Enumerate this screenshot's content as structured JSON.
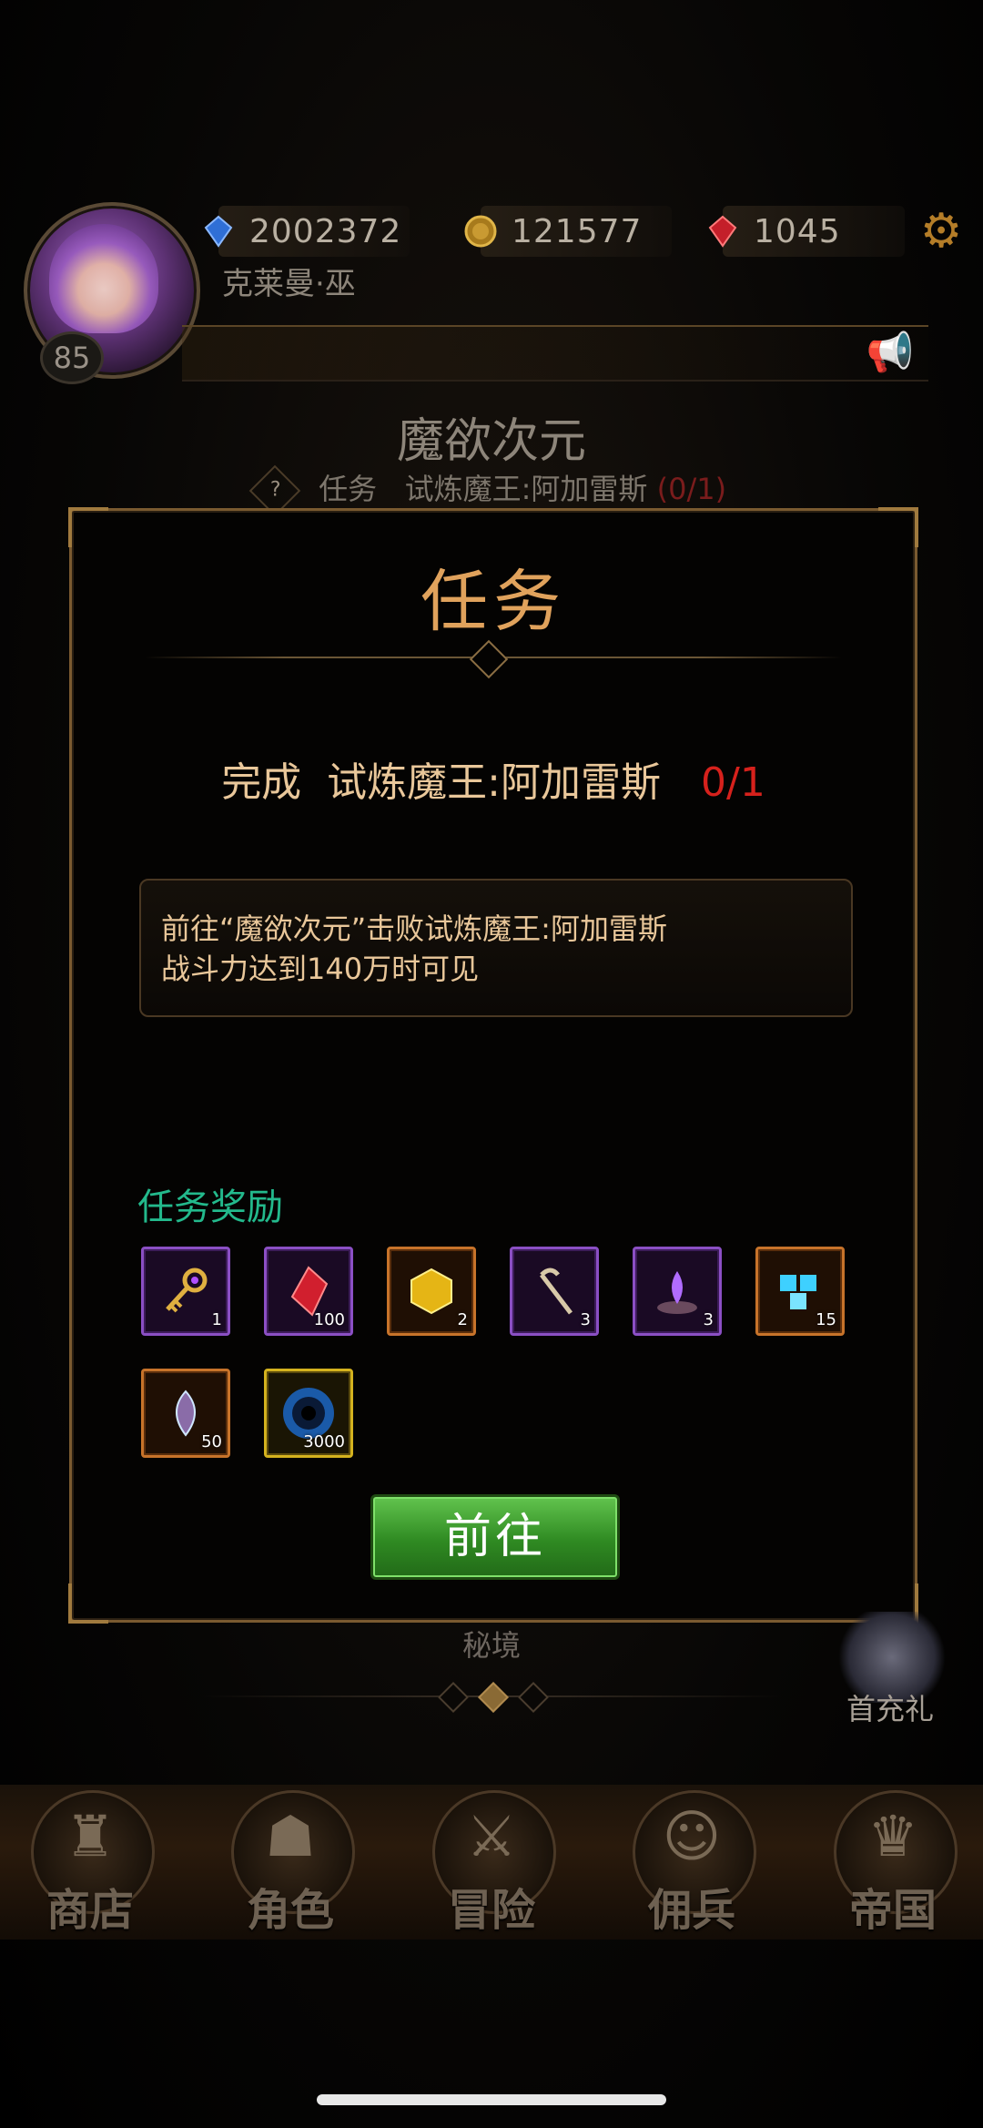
{
  "header": {
    "player_name": "克莱曼·巫",
    "level": "85",
    "currencies": [
      {
        "name": "diamond",
        "icon": "blue-gem-icon",
        "value": "2002372"
      },
      {
        "name": "gold",
        "icon": "gold-coin-icon",
        "value": "121577"
      },
      {
        "name": "ruby",
        "icon": "red-gem-icon",
        "value": "1045"
      }
    ]
  },
  "area": {
    "title": "魔欲次元",
    "quest_prefix": "任务",
    "quest_name": "试炼魔王:阿加雷斯",
    "quest_progress": "(0/1)"
  },
  "modal": {
    "title": "任务",
    "objective_prefix": "完成",
    "objective_target": "试炼魔王:阿加雷斯",
    "objective_count": "0/1",
    "description_line1": "前往“魔欲次元”击败试炼魔王:阿加雷斯",
    "description_line2": "战斗力达到140万时可见",
    "rewards_label": "任务奖励",
    "rewards": [
      {
        "icon": "golden-key-icon",
        "qty": "1"
      },
      {
        "icon": "red-crystal-icon",
        "qty": "100"
      },
      {
        "icon": "yellow-gem-icon",
        "qty": "2"
      },
      {
        "icon": "staff-icon",
        "qty": "3"
      },
      {
        "icon": "purple-flame-altar-icon",
        "qty": "3"
      },
      {
        "icon": "blue-cubes-icon",
        "qty": "15"
      },
      {
        "icon": "soul-crystal-icon",
        "qty": "50"
      },
      {
        "icon": "vortex-orb-icon",
        "qty": "3000"
      }
    ],
    "go_button": "前往"
  },
  "below": {
    "secret_label": "秘境",
    "first_charge_label": "首充礼"
  },
  "nav": {
    "items": [
      {
        "label": "商店",
        "icon": "castle-icon"
      },
      {
        "label": "角色",
        "icon": "hooded-figure-icon"
      },
      {
        "label": "冒险",
        "icon": "crossed-swords-icon"
      },
      {
        "label": "佣兵",
        "icon": "mercenary-portrait-icon"
      },
      {
        "label": "帝国",
        "icon": "crown-icon"
      }
    ]
  }
}
